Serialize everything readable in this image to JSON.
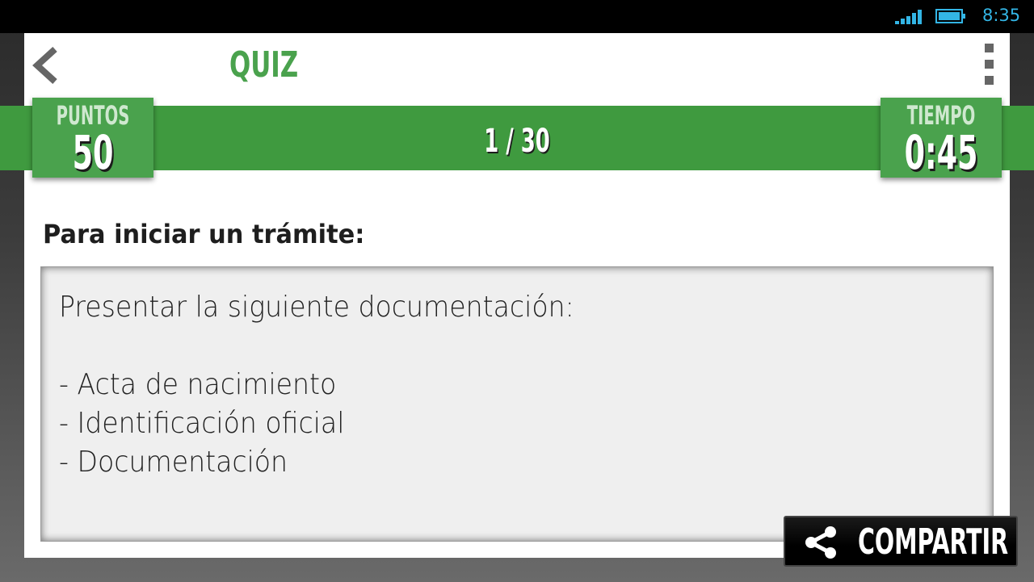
{
  "status_bar": {
    "time": "8:35",
    "icons": [
      "signal-icon",
      "battery-icon"
    ],
    "accent_color": "#33b5e5"
  },
  "header": {
    "title": "QUIZ",
    "back_icon": "chevron-left-icon",
    "menu_icon": "overflow-menu-icon"
  },
  "scoreboard": {
    "points_label": "PUNTOS",
    "points_value": "50",
    "progress": "1 / 30",
    "time_label": "TIEMPO",
    "time_value": "0:45",
    "bar_color": "#3f9a3f",
    "box_color": "#4aa24d"
  },
  "question": {
    "text": "Para iniciar un trámite:"
  },
  "answer": {
    "lines": [
      "Presentar la siguiente documentación:",
      "",
      "- Acta de nacimiento",
      "- Identificación oficial",
      "- Documentación"
    ]
  },
  "share": {
    "label": "COMPARTIR",
    "icon": "share-icon"
  }
}
